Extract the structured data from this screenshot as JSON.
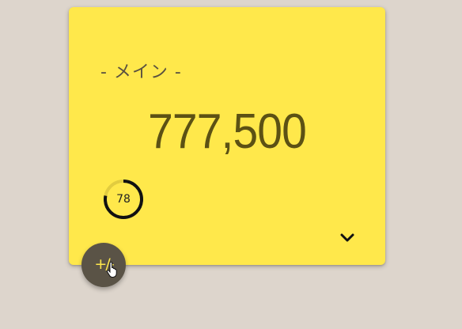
{
  "card": {
    "title": "- メイン -",
    "amount": "777,500",
    "background_color": "#ffe84b",
    "progress": {
      "value_label": "78",
      "fraction": 0.78,
      "ring_color": "#111111",
      "track_color": "#e2cc3f"
    },
    "expand_icon": "chevron-down-icon"
  },
  "fab": {
    "label": "+/-",
    "icon": "plus-minus-icon",
    "background_color": "#5a5346"
  },
  "page": {
    "background_color": "#ddd5cc"
  }
}
